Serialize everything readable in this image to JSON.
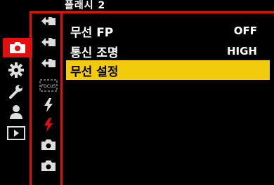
{
  "page": {
    "title": "플래시 2"
  },
  "menu": {
    "items": [
      {
        "label": "무선 FP",
        "value": "OFF"
      },
      {
        "label": "통신 조명",
        "value": "HIGH"
      },
      {
        "label": "무선 설정",
        "value": ""
      }
    ]
  },
  "sub_tabs": {
    "focus_label": "FOCUS"
  },
  "colors": {
    "accent": "#e01010",
    "highlight": "#f2cc0c"
  }
}
